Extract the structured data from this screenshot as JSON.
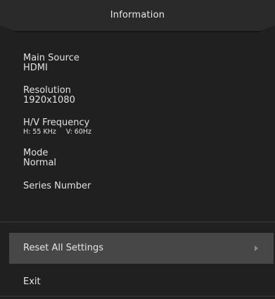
{
  "header": {
    "title": "Information"
  },
  "info": {
    "main_source_label": "Main Source",
    "main_source_value": "HDMI",
    "resolution_label": "Resolution",
    "resolution_value": "1920x1080",
    "hv_frequency_label": "H/V Frequency",
    "h_frequency": "H: 55 KHz",
    "v_frequency": "V: 60Hz",
    "mode_label": "Mode",
    "mode_value": "Normal",
    "series_number_label": "Series Number"
  },
  "menu": {
    "reset_label": "Reset All Settings",
    "exit_label": "Exit"
  }
}
